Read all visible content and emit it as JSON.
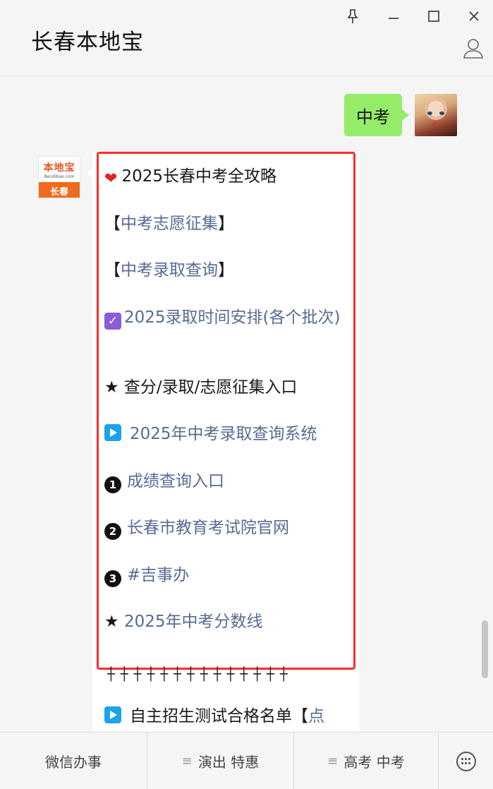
{
  "window": {
    "title": "长春本地宝",
    "buttons": [
      "pin",
      "minimize",
      "maximize",
      "close"
    ]
  },
  "chat": {
    "user_message": "中考",
    "account_logo": {
      "text": "本地宝",
      "subtext": "Bendibao.com",
      "city": "长春"
    },
    "reply": {
      "heading_prefix": "❤",
      "heading": "2025长春中考全攻略",
      "bracket_open": "【",
      "bracket_close": "】",
      "link_volunteer": "中考志愿征集",
      "link_admission_query": "中考录取查询",
      "link_schedule": "2025录取时间安排(各个批次)",
      "star_entry": "★ 查分/录取/志愿征集入口",
      "link_query_system": "2025年中考录取查询系统",
      "num1": "❶",
      "link_score_query": "成绩查询入口",
      "num2": "❷",
      "link_exam_institute": "长春市教育考试院官网",
      "num3": "❸",
      "link_jishiban": "#吉事办",
      "star2": "★",
      "link_score_line": "2025年中考分数线",
      "divider": "┼┼┼┼┼┼┼┼┼┼┼┼┼┼",
      "link_independent_prefix": "自主招生测试合格名单【",
      "link_independent_suffix": "点"
    }
  },
  "footer_menu": {
    "item1": "微信办事",
    "item2": "演出 特惠",
    "item3": "高考 中考",
    "menu_icon": "≡"
  },
  "colors": {
    "link": "#576b95",
    "bubble_self": "#95ec69",
    "highlight_border": "#ff2d2d"
  }
}
